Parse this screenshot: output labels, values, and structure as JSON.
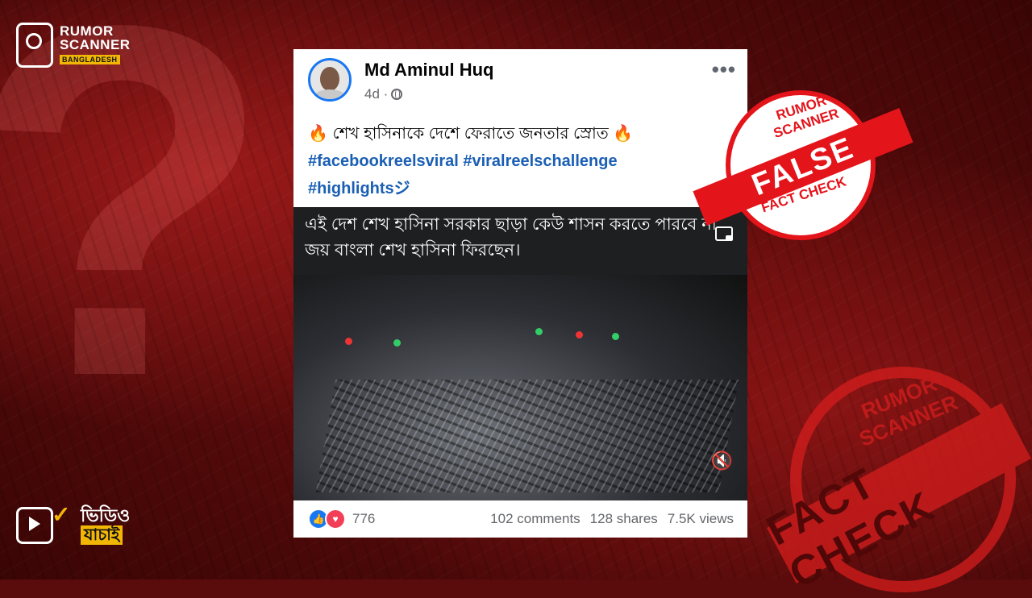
{
  "brand": {
    "logo_line1": "RUMOR",
    "logo_line2": "SCANNER",
    "logo_sub": "BANGLADESH",
    "badge_line1": "ভিডিও",
    "badge_line2": "যাচাই"
  },
  "post": {
    "author": "Md Aminul Huq",
    "time": "4d ·",
    "more": "•••",
    "caption_emoji": "🔥",
    "caption_text": "শেখ হাসিনাকে দেশে ফেরাতে জনতার স্রোত",
    "hashtags": [
      "#facebookreelsviral",
      "#viralreelschallenge",
      "#highlightsジ"
    ],
    "video_overlay_text": "এই দেশ শেখ হাসিনা সরকার ছাড়া কেউ শাসন করতে পারবে না জয় বাংলা শেখ হাসিনা ফিরছেন।",
    "mute_icon": "🔇",
    "reaction_count": "776",
    "comments": "102 comments",
    "shares": "128 shares",
    "views": "7.5K views"
  },
  "stamp_false": {
    "top": "RUMOR SCANNER",
    "label": "FALSE",
    "bottom": "FACT CHECK",
    "color": "#e4141b"
  },
  "stamp_bg": {
    "top": "RUMOR SCANNER",
    "label": "FACT CHECK",
    "color": "#d51d1d"
  }
}
